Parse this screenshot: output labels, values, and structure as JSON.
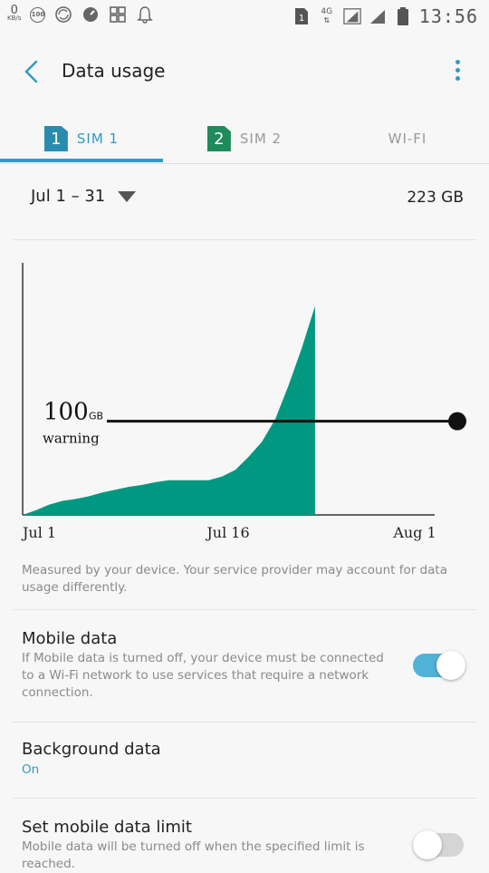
{
  "status_bar": {
    "speed_value": "0",
    "speed_unit": "KB/s",
    "badge_100": "100",
    "net_type": "4G",
    "time": "13:56",
    "sim_badge": "1"
  },
  "app_bar": {
    "title": "Data usage"
  },
  "tabs": [
    {
      "sim_number": "1",
      "label": "SIM 1",
      "color": "#2a8cad",
      "active": true
    },
    {
      "sim_number": "2",
      "label": "SIM 2",
      "color": "#1f8a5a",
      "active": false
    },
    {
      "label": "WI-FI",
      "active": false
    }
  ],
  "period": {
    "range": "Jul 1 – 31",
    "total": "223 GB"
  },
  "chart_data": {
    "type": "area",
    "x_labels": [
      "Jul 1",
      "Jul 16",
      "Aug 1"
    ],
    "warning_value": "100",
    "warning_unit": "GB",
    "warning_label": "warning",
    "color": "#009880",
    "x": [
      1,
      2,
      3,
      4,
      5,
      6,
      7,
      8,
      9,
      10,
      11,
      12,
      13,
      14,
      15,
      16,
      17,
      18,
      19,
      20,
      21,
      22,
      23
    ],
    "y": [
      0,
      5,
      11,
      15,
      17,
      20,
      24,
      27,
      30,
      32,
      35,
      37,
      37,
      37,
      37,
      41,
      48,
      62,
      78,
      102,
      138,
      178,
      223
    ],
    "x_range": [
      1,
      32
    ],
    "y_range": [
      0,
      240
    ],
    "warning_line": 100
  },
  "note": "Measured by your device. Your service provider may account for data usage differently.",
  "settings": {
    "mobile_data": {
      "title": "Mobile data",
      "desc": "If Mobile data is turned off, your device must be connected to a Wi-Fi network to use services that require a network connection.",
      "enabled": true
    },
    "background_data": {
      "title": "Background data",
      "value": "On"
    },
    "data_limit": {
      "title": "Set mobile data limit",
      "desc": "Mobile data will be turned off when the specified limit is reached.",
      "enabled": false
    }
  },
  "colors": {
    "accent": "#2f9bc4",
    "chart": "#009880",
    "toggle_on": "#4fb2d6",
    "toggle_off": "#d5d5d5"
  }
}
